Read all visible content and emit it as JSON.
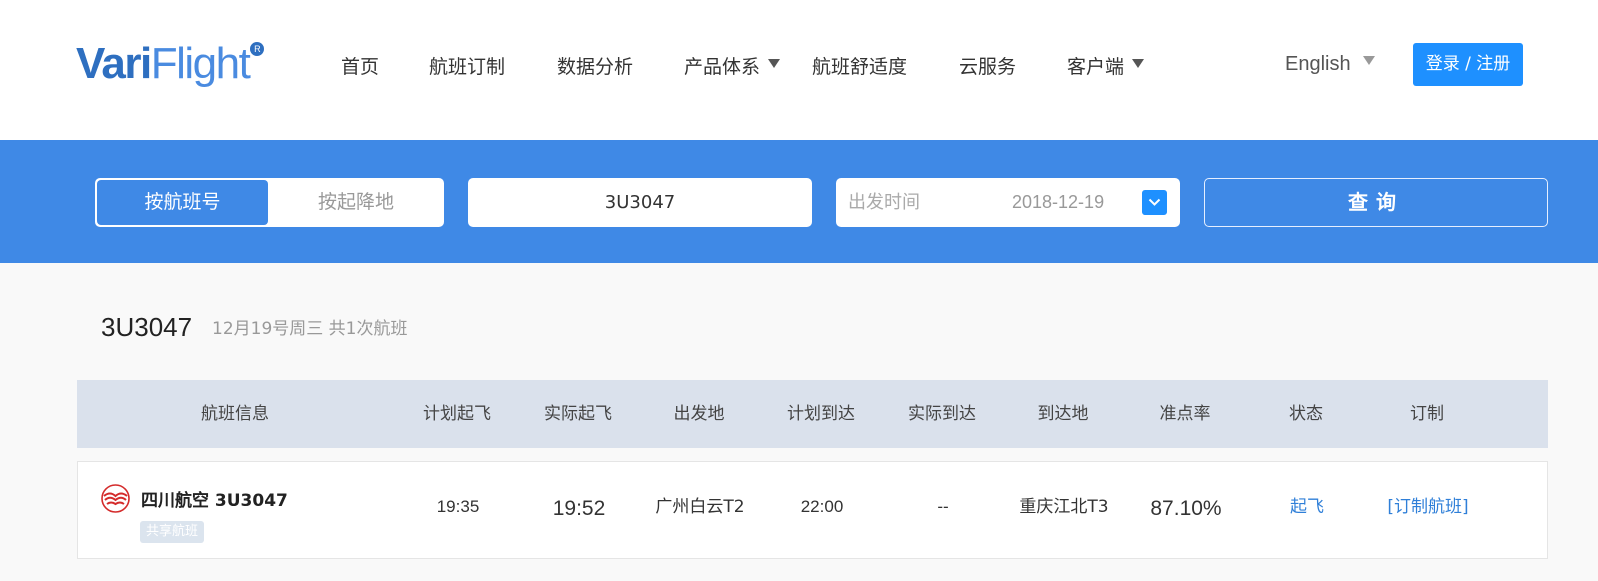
{
  "brand": {
    "logo_text_part1": "Vari",
    "logo_text_part2": "Flight",
    "logo_mark": "R"
  },
  "nav": {
    "items": [
      {
        "label": "首页"
      },
      {
        "label": "航班订制"
      },
      {
        "label": "数据分析"
      },
      {
        "label": "产品体系",
        "dropdown": true
      },
      {
        "label": "航班舒适度"
      },
      {
        "label": "云服务"
      },
      {
        "label": "客户端",
        "dropdown": true
      }
    ],
    "language": "English",
    "login_label": "登录 / 注册"
  },
  "search": {
    "mode_tabs": [
      {
        "label": "按航班号",
        "active": true
      },
      {
        "label": "按起降地",
        "active": false
      }
    ],
    "flight_number_value": "3U3047",
    "date_label": "出发时间",
    "date_value": "2018-12-19",
    "query_label": "查询"
  },
  "results": {
    "title": "3U3047",
    "subtitle": "12月19号周三 共1次航班",
    "columns": [
      "航班信息",
      "计划起飞",
      "实际起飞",
      "出发地",
      "计划到达",
      "实际到达",
      "到达地",
      "准点率",
      "状态",
      "订制"
    ],
    "rows": [
      {
        "airline_flight": "四川航空 3U3047",
        "badge": "共享航班",
        "sched_dep": "19:35",
        "actual_dep": "19:52",
        "origin": "广州白云T2",
        "sched_arr": "22:00",
        "actual_arr": "--",
        "destination": "重庆江北T3",
        "on_time_rate": "87.10%",
        "status": "起飞",
        "action": "[订制航班]"
      }
    ]
  },
  "colors": {
    "brand_blue": "#3f89e6",
    "button_blue": "#1e90ff",
    "link_blue": "#2f7fd8",
    "table_header_bg": "#dae1ec",
    "logo_dark": "#2e6fc0"
  },
  "icons": {
    "airline_logo": "sichuan-airlines-logo",
    "dropdown": "caret-down-icon",
    "date_toggle": "chevron-down-icon"
  }
}
